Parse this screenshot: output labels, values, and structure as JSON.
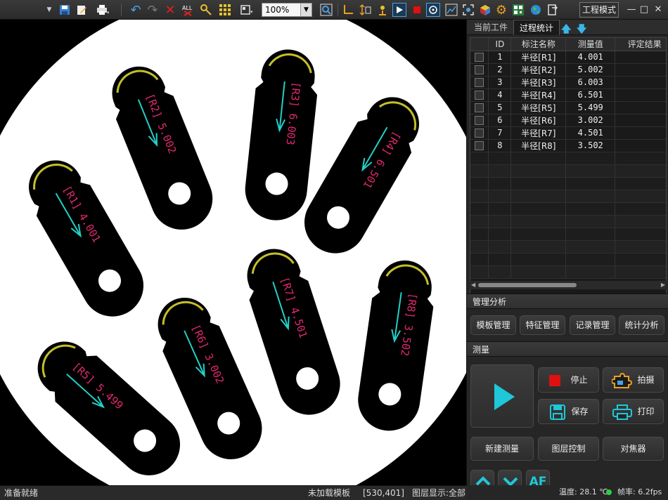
{
  "toolbar": {
    "zoom": "100%",
    "mode_button": "工程模式",
    "window_buttons": [
      "—",
      "□",
      "✕"
    ]
  },
  "tabs": [
    {
      "label": "当前工件"
    },
    {
      "label": "过程统计"
    }
  ],
  "table": {
    "headers": [
      "ID",
      "标注名称",
      "测量值",
      "评定结果"
    ],
    "rows": [
      {
        "id": "1",
        "name": "半径[R1]",
        "value": "4.001"
      },
      {
        "id": "2",
        "name": "半径[R2]",
        "value": "5.002"
      },
      {
        "id": "3",
        "name": "半径[R3]",
        "value": "6.003"
      },
      {
        "id": "4",
        "name": "半径[R4]",
        "value": "6.501"
      },
      {
        "id": "5",
        "name": "半径[R5]",
        "value": "5.499"
      },
      {
        "id": "6",
        "name": "半径[R6]",
        "value": "3.002"
      },
      {
        "id": "7",
        "name": "半径[R7]",
        "value": "4.501"
      },
      {
        "id": "8",
        "name": "半径[R8]",
        "value": "3.502"
      }
    ]
  },
  "management": {
    "title": "管理分析",
    "buttons": [
      "模板管理",
      "特征管理",
      "记录管理",
      "统计分析"
    ]
  },
  "measure": {
    "title": "测量",
    "stop": "停止",
    "capture": "拍摄",
    "save": "保存",
    "print": "打印",
    "new_measure": "新建测量",
    "layer_control": "图层控制",
    "focuser": "对焦器",
    "af": "AF"
  },
  "parts": [
    {
      "label": "[R1] 4.001"
    },
    {
      "label": "[R2] 5.002"
    },
    {
      "label": "[R3] 6.003"
    },
    {
      "label": "[R4] 6.501"
    },
    {
      "label": "[R5] 5.499"
    },
    {
      "label": "[R6] 3.002"
    },
    {
      "label": "[R7] 4.501"
    },
    {
      "label": "[R8] 3.502"
    }
  ],
  "status": {
    "ready": "准备就绪",
    "template": "未加载模板",
    "coords": "[530,401]",
    "layer": "图层显示:全部",
    "temperature": "温度: 28.1 ℃",
    "fps": "帧率: 6.2fps"
  },
  "colors": {
    "accent": "#39b7e8",
    "play": "#1ec8d8",
    "stop": "#e01010",
    "label": "#e0286e",
    "arrow": "#22d0c8",
    "highlight": "#e8e030"
  }
}
